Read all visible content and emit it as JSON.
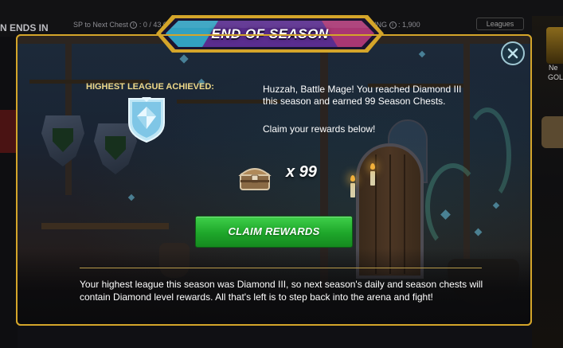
{
  "background": {
    "season_ends_label": "N ENDS IN",
    "sp_to_next_chest_label": "SP to Next Chest",
    "sp_value": ": 0 / 43,000",
    "rating_label": "ING",
    "rating_value": ": 1,900",
    "leagues_button": "Leagues",
    "side_label": "Ne",
    "side_label_2": "GOL"
  },
  "modal": {
    "title": "END OF SEASON",
    "highest_league_label": "HIGHEST LEAGUE ACHIEVED:",
    "league_badge_icon": "diamond-league-badge",
    "message": "Huzzah, Battle Mage! You reached Diamond III this season and earned 99 Season Chests.",
    "claim_prompt": "Claim your rewards below!",
    "chest_icon": "season-chest-icon",
    "chest_count": "x 99",
    "claim_button": "CLAIM REWARDS",
    "footer": "Your highest league this season was Diamond III, so next season's daily and season chests will contain Diamond level rewards. All that's left is to step back into the arena and fight!",
    "close_icon": "close-icon"
  },
  "colors": {
    "frame_gold": "#d4a52a",
    "claim_green": "#1ea62a",
    "title_banner_purple": "#5a2d8f",
    "title_banner_teal": "#2bb6c9",
    "league_label_gold": "#efd98a"
  }
}
